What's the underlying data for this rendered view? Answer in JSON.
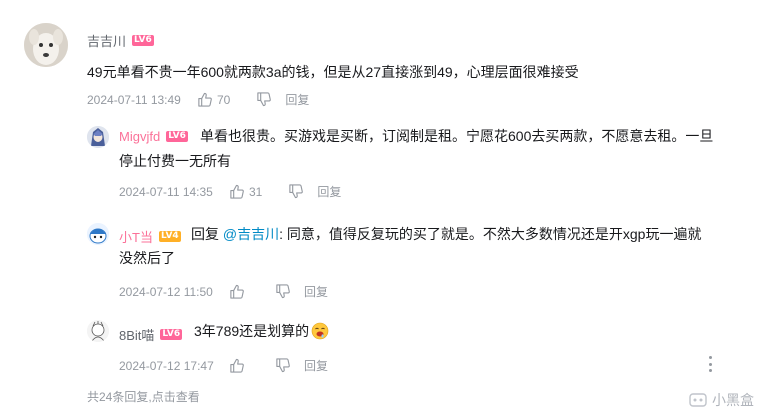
{
  "main_comment": {
    "user": "吉吉川",
    "level": "LV6",
    "text": "49元单看不贵一年600就两款3a的钱，但是从27直接涨到49，心理层面很难接受",
    "time": "2024-07-11 13:49",
    "likes": "70",
    "reply_label": "回复"
  },
  "replies": [
    {
      "user": "Migvjfd",
      "level": "LV6",
      "text_line1": "单看也很贵。买游戏是买断，订阅制是租。宁愿花600去买两款，不愿意去租。一旦",
      "text_line2": "停止付费一无所有",
      "time": "2024-07-11 14:35",
      "likes": "31",
      "reply_label": "回复"
    },
    {
      "user": "小T当",
      "level": "LV4",
      "reply_prefix": "回复",
      "mention": "@吉吉川",
      "text_line1": ": 同意，值得反复玩的买了就是。不然大多数情况还是开xgp玩一遍就",
      "text_line2": "没然后了",
      "time": "2024-07-12 11:50",
      "reply_label": "回复"
    },
    {
      "user": "8Bit喵",
      "level": "LV6",
      "text": "3年789还是划算的",
      "time": "2024-07-12 17:47",
      "reply_label": "回复"
    }
  ],
  "more": {
    "count_text": "共24条回复,",
    "action_text": "点击查看"
  },
  "watermark": "小黑盒",
  "colors": {
    "level6": "#ff6699",
    "level4": "#ffb027",
    "link": "#008ac5",
    "meta": "#9499a0"
  }
}
